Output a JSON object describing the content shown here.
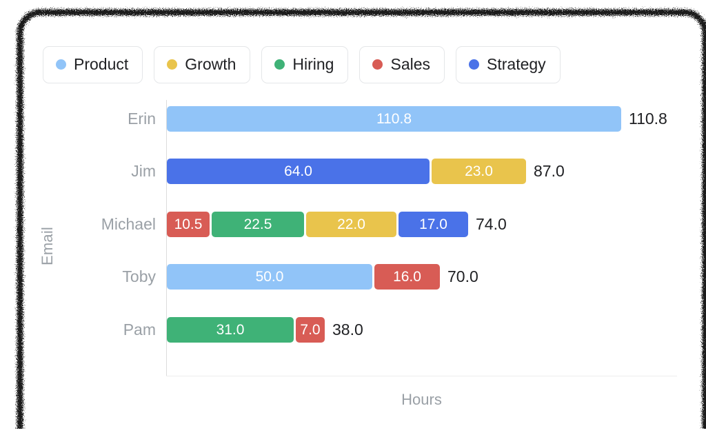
{
  "chart_data": {
    "type": "bar",
    "orientation": "horizontal",
    "stacked": true,
    "title": "",
    "xlabel": "Hours",
    "ylabel": "Email",
    "categories": [
      "Erin",
      "Jim",
      "Michael",
      "Toby",
      "Pam"
    ],
    "series": [
      {
        "name": "Product",
        "color": "#91c4f8",
        "values": [
          110.8,
          0,
          0,
          50.0,
          0
        ]
      },
      {
        "name": "Growth",
        "color": "#e9c44c",
        "values": [
          0,
          23.0,
          22.0,
          0,
          0
        ]
      },
      {
        "name": "Hiring",
        "color": "#3fb277",
        "values": [
          0,
          0,
          22.5,
          0,
          31.0
        ]
      },
      {
        "name": "Sales",
        "color": "#d85c55",
        "values": [
          0,
          0,
          10.5,
          16.0,
          7.0
        ]
      },
      {
        "name": "Strategy",
        "color": "#4a72e8",
        "values": [
          0,
          64.0,
          0,
          0,
          0
        ]
      }
    ],
    "totals": [
      110.8,
      87.0,
      74.0,
      70.0,
      38.0
    ],
    "total_labels": [
      "110.8",
      "87.0",
      "74.0",
      "70.0",
      "38.0"
    ],
    "rows": [
      {
        "category": "Erin",
        "total_label": "110.8",
        "segments": [
          {
            "series": "Product",
            "value": 110.8,
            "label": "110.8",
            "color": "#91c4f8"
          }
        ]
      },
      {
        "category": "Jim",
        "total_label": "87.0",
        "segments": [
          {
            "series": "Strategy",
            "value": 64.0,
            "label": "64.0",
            "color": "#4a72e8"
          },
          {
            "series": "Growth",
            "value": 23.0,
            "label": "23.0",
            "color": "#e9c44c"
          }
        ]
      },
      {
        "category": "Michael",
        "total_label": "74.0",
        "segments": [
          {
            "series": "Sales",
            "value": 10.5,
            "label": "10.5",
            "color": "#d85c55"
          },
          {
            "series": "Hiring",
            "value": 22.5,
            "label": "22.5",
            "color": "#3fb277"
          },
          {
            "series": "Growth",
            "value": 22.0,
            "label": "22.0",
            "color": "#e9c44c"
          },
          {
            "series": "Strategy",
            "value": 17.0,
            "label": "17.0",
            "color": "#4a72e8"
          }
        ]
      },
      {
        "category": "Toby",
        "total_label": "70.0",
        "segments": [
          {
            "series": "Product",
            "value": 50.0,
            "label": "50.0",
            "color": "#91c4f8"
          },
          {
            "series": "Sales",
            "value": 16.0,
            "label": "16.0",
            "color": "#d85c55"
          }
        ]
      },
      {
        "category": "Pam",
        "total_label": "38.0",
        "segments": [
          {
            "series": "Hiring",
            "value": 31.0,
            "label": "31.0",
            "color": "#3fb277"
          },
          {
            "series": "Sales",
            "value": 7.0,
            "label": "7.0",
            "color": "#d85c55"
          }
        ]
      }
    ],
    "grid": false,
    "legend_position": "top-left"
  },
  "legend": {
    "items": [
      {
        "label": "Product",
        "color": "#91c4f8"
      },
      {
        "label": "Growth",
        "color": "#e9c44c"
      },
      {
        "label": "Hiring",
        "color": "#3fb277"
      },
      {
        "label": "Sales",
        "color": "#d85c55"
      },
      {
        "label": "Strategy",
        "color": "#4a72e8"
      }
    ]
  },
  "axes": {
    "x_title": "Hours",
    "y_title": "Email"
  }
}
